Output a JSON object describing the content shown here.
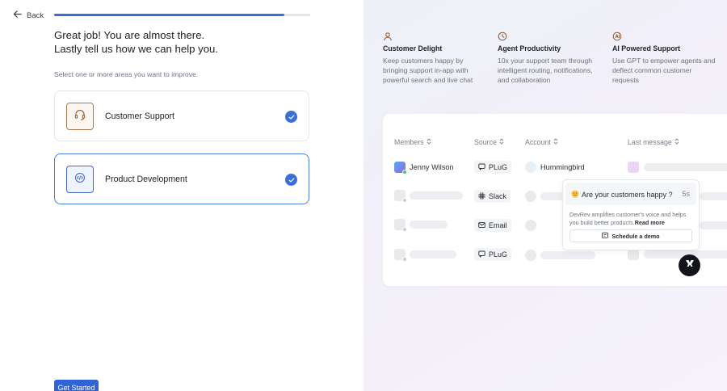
{
  "nav": {
    "back_label": "Back"
  },
  "progress": {
    "fraction": 0.9
  },
  "headline": {
    "line1": "Great job! You are almost there.",
    "line2": "Lastly tell us how we can help you."
  },
  "hint": "Select one or more areas you want to improve.",
  "options": [
    {
      "label": "Customer Support",
      "icon": "headset-icon",
      "selected": true
    },
    {
      "label": "Product Development",
      "icon": "code-icon",
      "selected": true
    }
  ],
  "cta_label": "Get Started",
  "features": [
    {
      "icon": "person-icon",
      "title": "Customer Delight",
      "desc": "Keep customers happy by bringing support in-app with powerful search and live chat"
    },
    {
      "icon": "clock-icon",
      "title": "Agent Productivity",
      "desc": "10x your support team through intelligent routing, notifications, and collaboration"
    },
    {
      "icon": "ai-icon",
      "title": "AI Powered Support",
      "desc": "Use GPT to empower agents and deflect common customer requests"
    }
  ],
  "table": {
    "headers": {
      "members": "Members",
      "source": "Source",
      "account": "Account",
      "last_message": "Last message"
    },
    "rows": [
      {
        "member": "Jenny Wilson",
        "source": "PLuG",
        "source_icon": "chat-bubble-icon",
        "account": "Hummingbird"
      },
      {
        "source": "Slack",
        "source_icon": "slack-icon"
      },
      {
        "source": "Email",
        "source_icon": "email-icon"
      },
      {
        "source": "PLuG",
        "source_icon": "chat-bubble-icon"
      }
    ]
  },
  "popup": {
    "question": "Are your customers happy ?",
    "time": "5s",
    "body": "DevRev amplifies customer's voice and helps you build better products.",
    "read_more": "Read more",
    "demo_label": "Schedule a demo"
  },
  "colors": {
    "accent": "#3b6fd8",
    "cta": "#2f63d6"
  }
}
